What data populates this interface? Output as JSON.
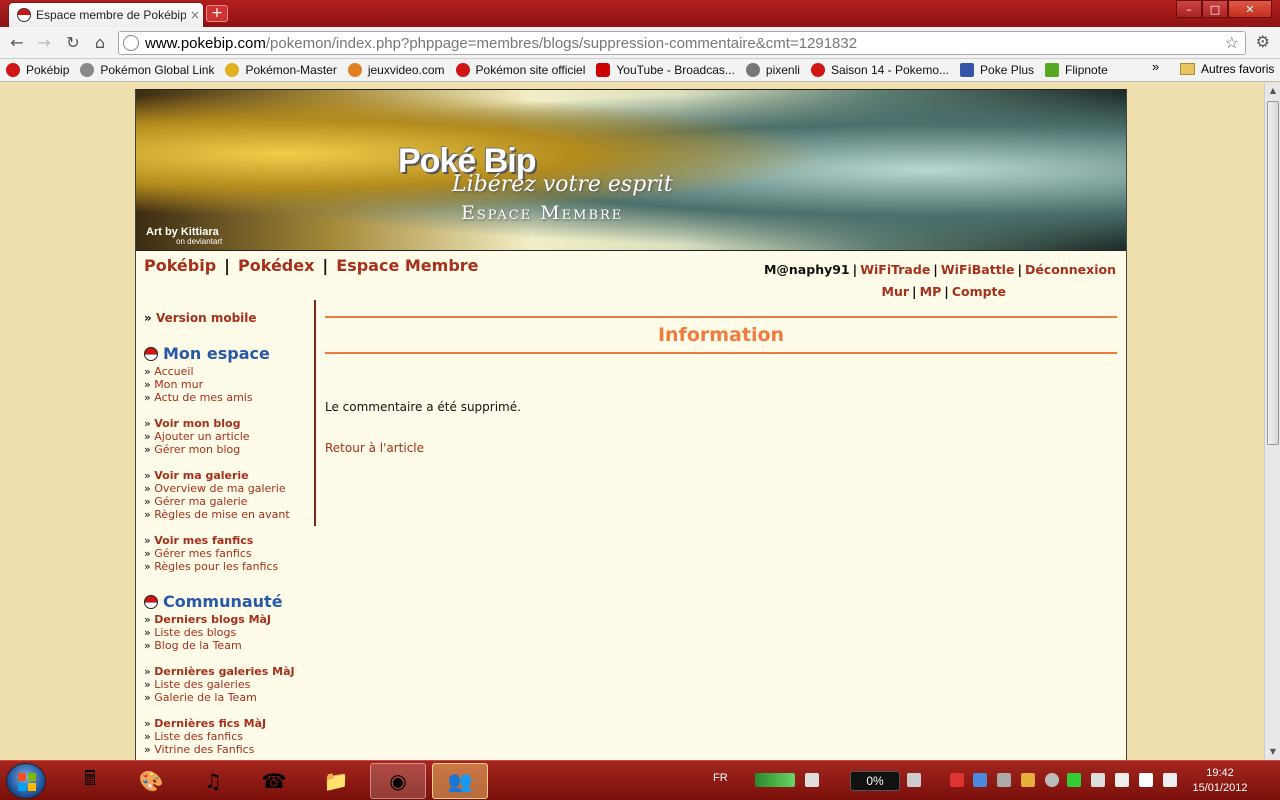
{
  "browser": {
    "tab_title": "Espace membre de Pokébip",
    "tab_close": "×",
    "new_tab": "+",
    "url_host": "www.pokebip.com",
    "url_path": "/pokemon/index.php?phppage=membres/blogs/suppression-commentaire&cmt=1291832",
    "bookmarks": [
      {
        "label": "Pokébip",
        "color": "#d01515"
      },
      {
        "label": "Pokémon Global Link",
        "color": "#888888"
      },
      {
        "label": "Pokémon-Master",
        "color": "#e0b020"
      },
      {
        "label": "jeuxvideo.com",
        "color": "#e08020"
      },
      {
        "label": "Pokémon site officiel",
        "color": "#d01515"
      },
      {
        "label": "YouTube - Broadcas...",
        "color": "#cc0000"
      },
      {
        "label": "pixenli",
        "color": "#777777"
      },
      {
        "label": "Saison 14 - Pokemo...",
        "color": "#d01515"
      },
      {
        "label": "Poke Plus",
        "color": "#3355aa"
      },
      {
        "label": "Flipnote",
        "color": "#55aa22"
      }
    ],
    "bookmarks_more": "»",
    "other_bookmarks": "Autres favoris"
  },
  "banner": {
    "logo": "Poké Bip",
    "slogan": "Libérez votre esprit",
    "section": "Espace Membre",
    "art_credit": "Art by Kittiara",
    "art_sub": "on deviantart"
  },
  "mainnav": {
    "items": [
      "Pokébip",
      "Pokédex",
      "Espace Membre"
    ],
    "separator": "|"
  },
  "usernav": {
    "username": "M@naphy91",
    "row1": [
      "WiFiTrade",
      "WiFiBattle",
      "Déconnexion"
    ],
    "row2": [
      "Mur",
      "MP",
      "Compte"
    ],
    "separator": "|"
  },
  "sidebar": {
    "mobile": "Version mobile",
    "section1_title": "Mon espace",
    "group1": [
      "Accueil",
      "Mon mur",
      "Actu de mes amis"
    ],
    "group2": [
      "Voir mon blog",
      "Ajouter un article",
      "Gérer mon blog"
    ],
    "group3": [
      "Voir ma galerie",
      "Overview de ma galerie",
      "Gérer ma galerie",
      "Règles de mise en avant"
    ],
    "group4": [
      "Voir mes fanfics",
      "Gérer mes fanfics",
      "Règles pour les fanfics"
    ],
    "section2_title": "Communauté",
    "group5": [
      "Derniers blogs MàJ",
      "Liste des blogs",
      "Blog de la Team"
    ],
    "group6": [
      "Dernières galeries MàJ",
      "Liste des galeries",
      "Galerie de la Team"
    ],
    "group7": [
      "Dernières fics MàJ",
      "Liste des fanfics",
      "Vitrine des Fanfics"
    ]
  },
  "content": {
    "title": "Information",
    "message": "Le commentaire a été supprimé.",
    "back_link": "Retour à l'article"
  },
  "taskbar": {
    "lang": "FR",
    "meter": "0%",
    "time": "19:42",
    "date": "15/01/2012"
  },
  "colors": {
    "accent_orange": "#ef7d3d",
    "link_red": "#a5301b",
    "heading_blue": "#2859a8",
    "taskbar_red": "#8e1313"
  }
}
